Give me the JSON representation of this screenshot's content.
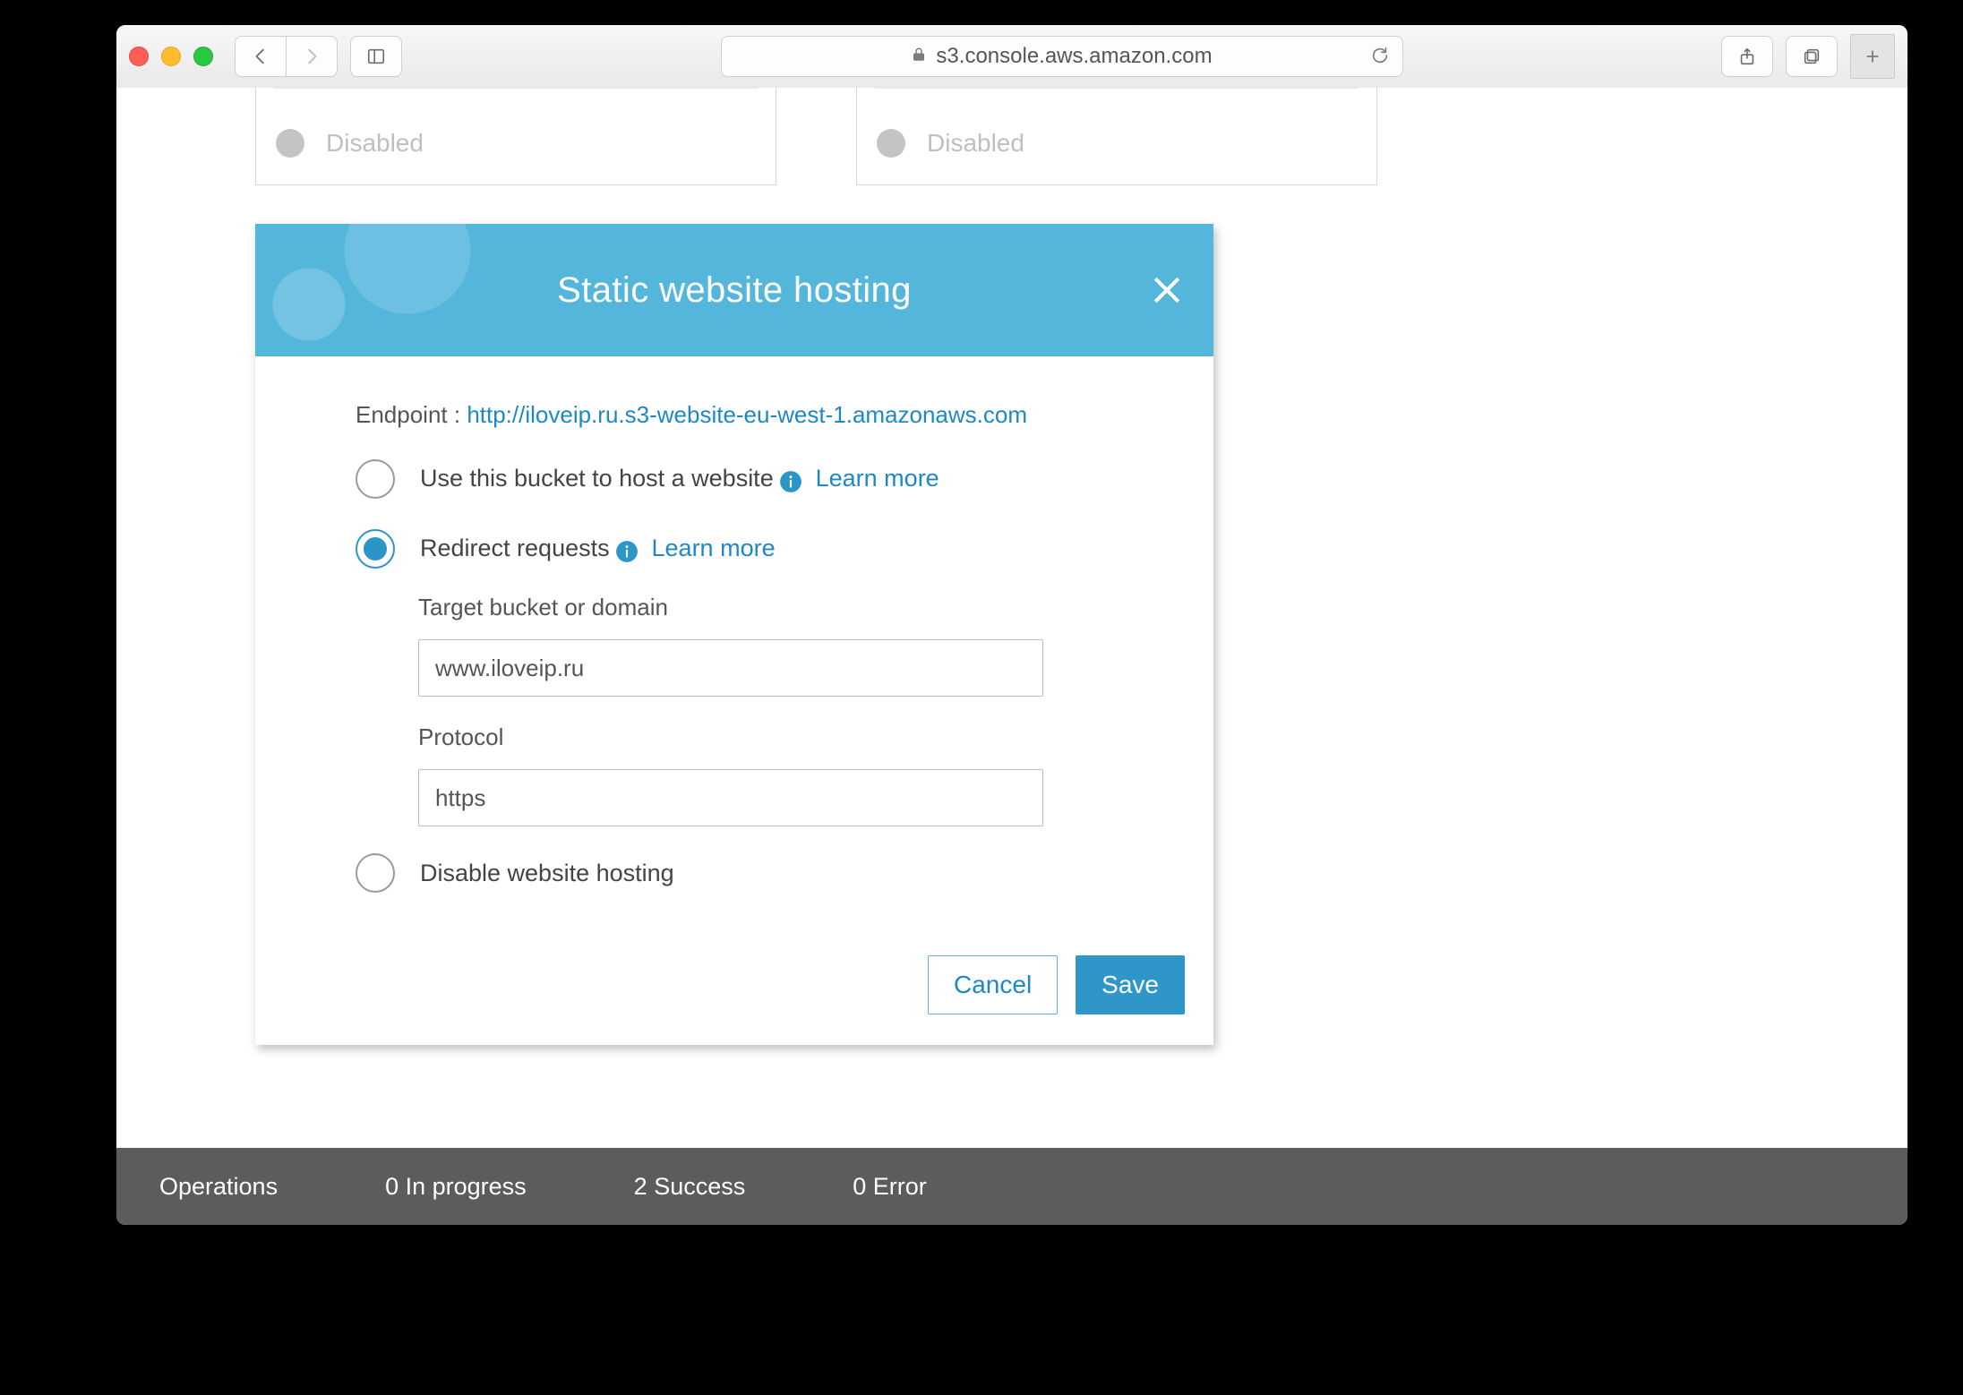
{
  "browser": {
    "address": "s3.console.aws.amazon.com"
  },
  "cards": {
    "c1_status": "Disabled",
    "c2_status": "Disabled"
  },
  "modal": {
    "title": "Static website hosting",
    "endpoint_label": "Endpoint : ",
    "endpoint_url": "http://iloveip.ru.s3-website-eu-west-1.amazonaws.com",
    "opt_host_label": "Use this bucket to host a website",
    "opt_redirect_label": "Redirect requests",
    "opt_disable_label": "Disable website hosting",
    "learn_more": "Learn more",
    "target_label": "Target bucket or domain",
    "target_value": "www.iloveip.ru",
    "protocol_label": "Protocol",
    "protocol_value": "https",
    "cancel": "Cancel",
    "save": "Save"
  },
  "footer": {
    "operations": "Operations",
    "in_progress": "0 In progress",
    "success": "2 Success",
    "error": "0 Error"
  }
}
